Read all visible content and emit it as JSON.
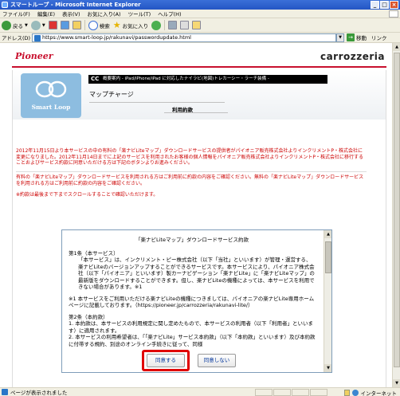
{
  "window": {
    "title": "スマートループ - Microsoft Internet Explorer",
    "minimize": "_",
    "maximize": "□",
    "close": "×"
  },
  "menu": {
    "items": [
      "ファイル(F)",
      "編集(E)",
      "表示(V)",
      "お気に入り(A)",
      "ツール(T)",
      "ヘルプ(H)"
    ]
  },
  "toolbar": {
    "back_label": "戻る",
    "search_label": "検索",
    "favorites_label": "お気に入り"
  },
  "address": {
    "label": "アドレス(D)",
    "url": "https://www.smart-loop.jp/rakunavi/passwordupdate.html",
    "go_label": "移動",
    "links_label": "リンク"
  },
  "brand": {
    "pioneer": "Pioneer",
    "carrozzeria": "carrozzeria"
  },
  "header": {
    "cc_mark": "CC",
    "strip_text": "概要案内 - iPad/iPhone/iPad に対応したナイラビ(地図)トレカーシー・ラーチ装備 -",
    "logo_text": "Smart Loop",
    "title": "マップチャージ",
    "subtitle": "利用約款"
  },
  "notices": {
    "n1": "2012年11月15日より本サービスの中の有料の「楽ナビLiteマップ」ダウンロードサービスの提供者がパイオニア販売株式会社よりインクリメントP・株式会社に変更になりました。2012年11月14日までに上記のサービスを利用されたお客様の個人情報をパイオニア販売株式会社よりインクリメントP・株式会社に移行することおよびサービス約款に同意いただける方は下記のボタンよりお進みください。",
    "n2": "有料の「楽ナビLiteマップ」ダウンロードサービスを利用される方はご利用前に約款の内容をご確認ください。無料の「楽ナビLiteマップ」ダウンロードサービスを利用される方はご利用前に約款の内容をご確認ください。",
    "n3": "※約款は最後まで下までスクロールすることで確認いただけます。"
  },
  "terms": {
    "title": "「楽ナビLiteマップ」ダウンロードサービス約款",
    "article1_heading": "第1条（本サービス）",
    "article1_body": "「本サービス」は、インクリメント・ピー株式会社（以下「当社」といいます）が管理・運営する、楽ナビLiteのバージョンアップすることができるサービスです。本サービスにより、パイオニア株式会社（以下「パイオニア」といいます）製カーナビゲーション「楽ナビLite」に「楽ナビLiteマップ」の最新版をダウンロードすることができます。但し、楽ナビLiteの機種によっては、本サービスを利用できない場合があります。※1",
    "note1": "※1 本サービスをご利用いただける楽ナビLiteの機種につきましては、パイオニアの楽ナビLite専用ホームページに記載しております。（https://pioneer.jp/carrozzeria/rakunavi-lite/）",
    "article2_heading": "第2条（本約款）",
    "article2_item1": "1. 本約款は、本サービスの利用規定に関し定めたもので、本サービスの利用者（以下「利用者」といいます）に適用されます。",
    "article2_item2": "2. 本サービスの利用希望者は、「「楽ナビLite」サービス本約款」（以下「本約款」といいます）及び本約款に付帯する規約、別途のオンライン手続きに従って、同様"
  },
  "buttons": {
    "agree": "同意する",
    "disagree": "同意しない"
  },
  "status": {
    "text": "ページが表示されました",
    "zone": "インターネット"
  }
}
